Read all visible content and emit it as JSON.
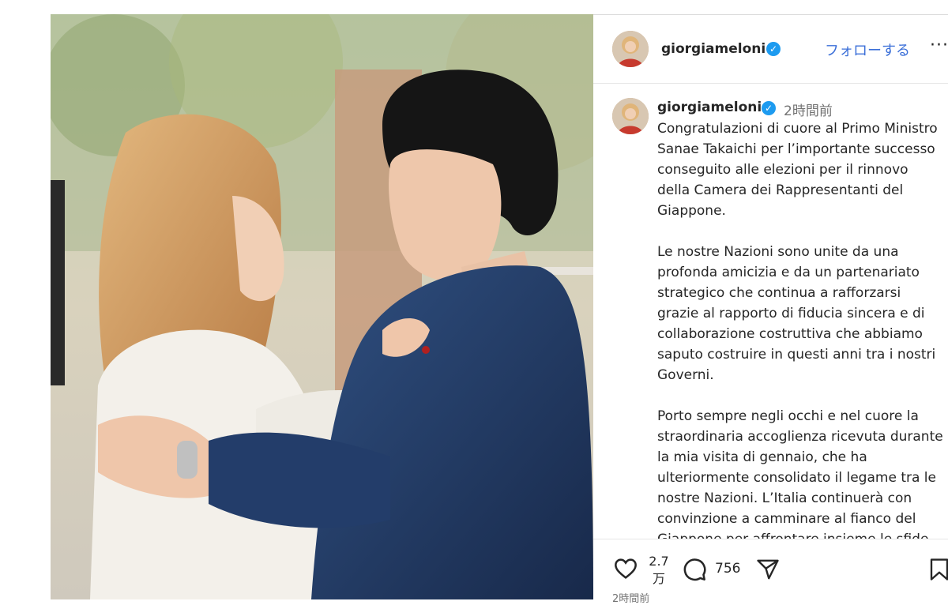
{
  "post": {
    "username": "giorgiameloni",
    "follow_label": "フォローする",
    "more_label": "···",
    "verified_mark": "✓",
    "time_ago": "2時間前",
    "caption_paragraphs": [
      "Congratulazioni di cuore al Primo Ministro Sanae Takaichi per l’importante successo conseguito alle elezioni per il rinnovo della Camera dei Rappresentanti del Giappone.",
      "Le nostre Nazioni sono unite da una profonda amicizia e da un partenariato strategico che continua a rafforzarsi grazie al rapporto di fiducia sincera e di collaborazione costruttiva che abbiamo saputo costruire in questi anni tra i nostri Governi.",
      "Porto sempre negli occhi e nel cuore la straordinaria accoglienza ricevuta durante la mia visita di gennaio, che ha ulteriormente consolidato il legame tra le nostre Nazioni. L’Italia continuerà con convinzione a camminare al fianco del Giappone per affrontare insieme le sfide"
    ],
    "likes_count": "2.7",
    "likes_unit": "万",
    "comments_count": "756",
    "posted_time": "2時間前",
    "icons": {
      "like": "heart-icon",
      "comment": "comment-icon",
      "share": "share-icon",
      "save": "bookmark-icon",
      "verified": "verified-badge-icon"
    },
    "colors": {
      "verified": "#1d9bf0",
      "follow": "#3b6fd8",
      "text": "#262626",
      "muted": "#737373"
    }
  }
}
